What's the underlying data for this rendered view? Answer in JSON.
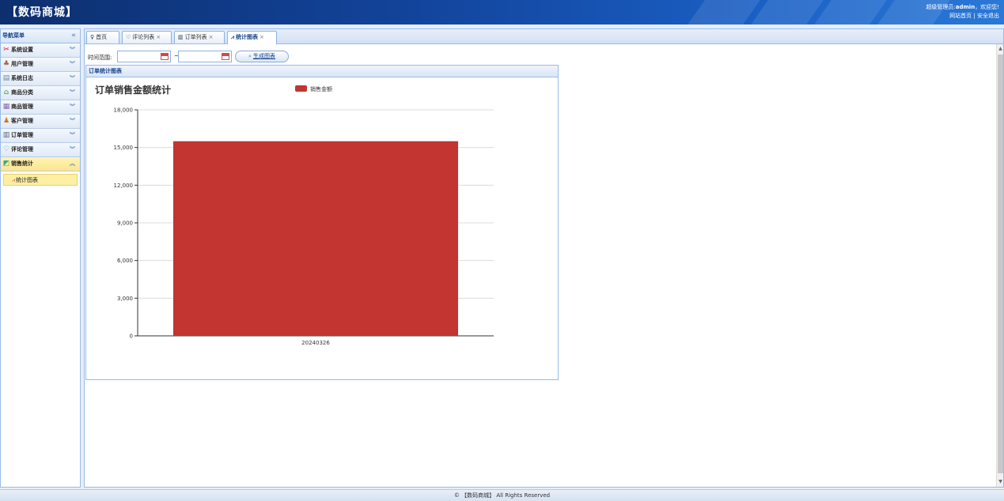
{
  "header": {
    "title": "【数码商城】",
    "user_greeting_prefix": "超级管理员:",
    "user_name": "admin",
    "user_greeting_suffix": "，欢迎您!",
    "link_home": "网站首页",
    "separator": "|",
    "link_logout": "安全退出"
  },
  "sidebar": {
    "title": "导航菜单",
    "collapse_glyph": "«",
    "items": [
      {
        "label": "系统设置",
        "icon": "tools-icon",
        "glyph": "✂",
        "color": "#c03"
      },
      {
        "label": "用户管理",
        "icon": "users-icon",
        "glyph": "♣",
        "color": "#a63"
      },
      {
        "label": "系统日志",
        "icon": "log-icon",
        "glyph": "▤",
        "color": "#68a"
      },
      {
        "label": "商品分类",
        "icon": "category-icon",
        "glyph": "⌂",
        "color": "#6a6"
      },
      {
        "label": "商品管理",
        "icon": "goods-icon",
        "glyph": "▦",
        "color": "#86a"
      },
      {
        "label": "客户管理",
        "icon": "customer-icon",
        "glyph": "♟",
        "color": "#c72"
      },
      {
        "label": "订单管理",
        "icon": "order-icon",
        "glyph": "▥",
        "color": "#567"
      },
      {
        "label": "评论管理",
        "icon": "comment-icon",
        "glyph": "♡",
        "color": "#58a"
      },
      {
        "label": "销售统计",
        "icon": "chart-icon",
        "glyph": "◩",
        "color": "#3a8"
      }
    ],
    "sub_item": {
      "label": "统计图表",
      "icon": "line-chart-icon",
      "glyph": "⩘"
    }
  },
  "tabs": [
    {
      "label": "首页",
      "icon": "bulb-icon",
      "glyph": "♀",
      "closable": false
    },
    {
      "label": "评论列表",
      "icon": "comment-icon",
      "glyph": "♡",
      "closable": true
    },
    {
      "label": "订单列表",
      "icon": "order-icon",
      "glyph": "▥",
      "closable": true
    },
    {
      "label": "统计图表",
      "icon": "line-chart-icon",
      "glyph": "⩘",
      "closable": true
    }
  ],
  "toolbar": {
    "range_label": "时间范围:",
    "start_value": "",
    "end_value": "",
    "tilde": "~",
    "generate_label": "生成图表"
  },
  "panel_title": "订单统计图表",
  "colors": {
    "bar": "#c23531",
    "accent": "#15428b"
  },
  "chart_data": {
    "type": "bar",
    "title": "订单销售金额统计",
    "categories": [
      "20240326"
    ],
    "series": [
      {
        "name": "销售金额",
        "values": [
          15500
        ]
      }
    ],
    "ylim": [
      0,
      18000
    ],
    "yticks": [
      0,
      3000,
      6000,
      9000,
      12000,
      15000,
      18000
    ],
    "ytick_labels": [
      "0",
      "3,000",
      "6,000",
      "9,000",
      "12,000",
      "15,000",
      "18,000"
    ],
    "grid": true,
    "legend": "top-center"
  },
  "footer": {
    "text": "© 【数码商城】 All Rights Reserved"
  }
}
